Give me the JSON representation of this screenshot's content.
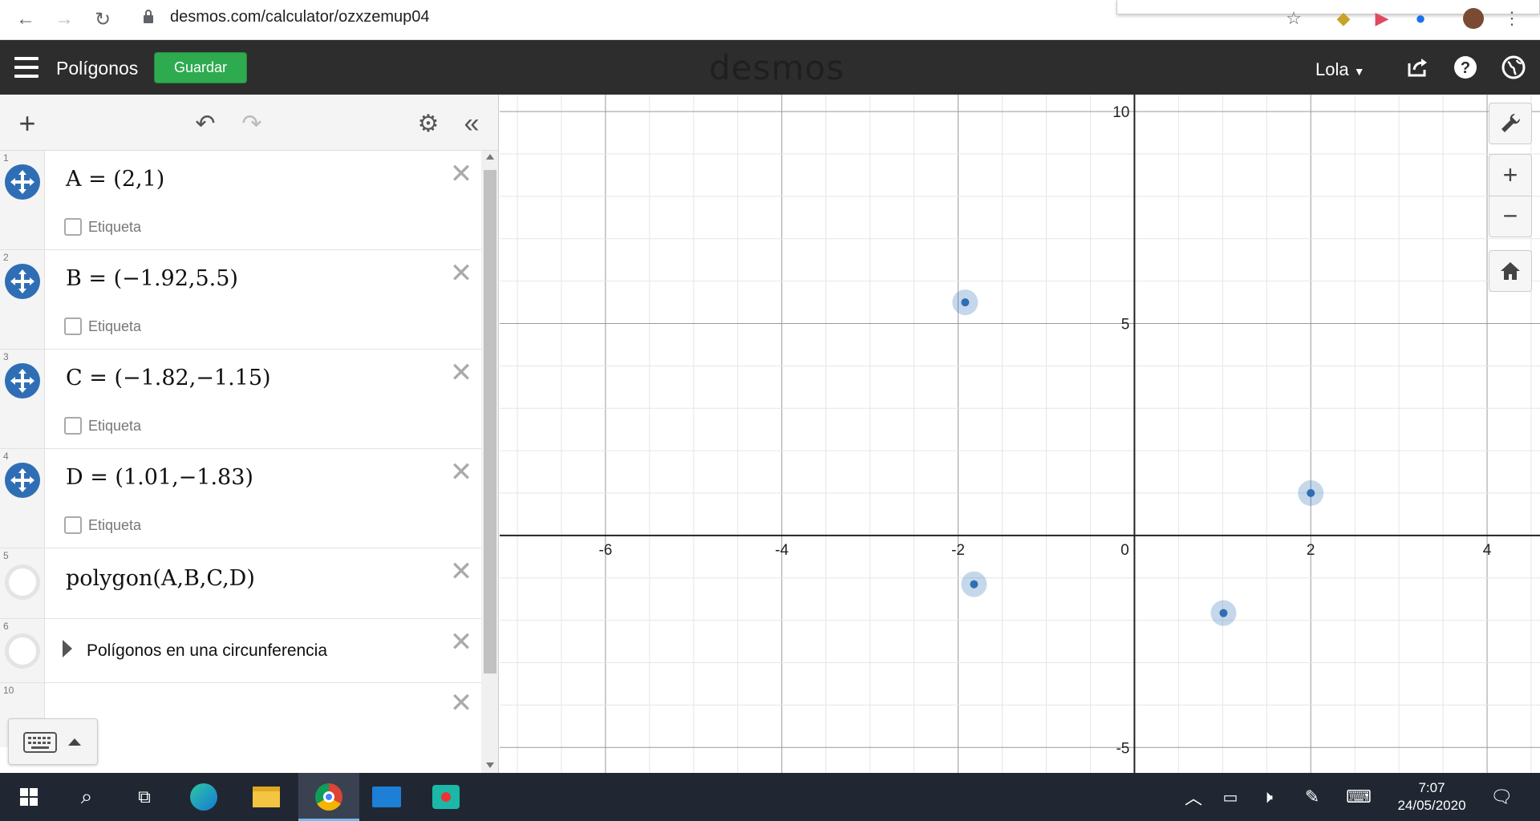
{
  "browser": {
    "url": "desmos.com/calculator/ozxzemup04"
  },
  "header": {
    "title": "Polígonos",
    "save_label": "Guardar",
    "brand": "desmos",
    "user": "Lola"
  },
  "expressions": [
    {
      "num": "1",
      "latex": "A = (2,1)",
      "label_toggle": "Etiqueta"
    },
    {
      "num": "2",
      "latex": "B = (−1.92,5.5)",
      "label_toggle": "Etiqueta"
    },
    {
      "num": "3",
      "latex": "C = (−1.82,−1.15)",
      "label_toggle": "Etiqueta"
    },
    {
      "num": "4",
      "latex": "D = (1.01,−1.83)",
      "label_toggle": "Etiqueta"
    },
    {
      "num": "5",
      "latex": "polygon(A,B,C,D)"
    },
    {
      "num": "6",
      "folder": "Polígonos en una circunferencia"
    },
    {
      "num": "10",
      "latex": ""
    }
  ],
  "graph": {
    "x_ticks": [
      "-6",
      "-4",
      "-2",
      "0",
      "2",
      "4"
    ],
    "y_ticks": [
      "10",
      "5",
      "-5"
    ],
    "xlim": [
      -7.2,
      4.6
    ],
    "ylim": [
      -5.6,
      10.4
    ],
    "points": [
      {
        "name": "A",
        "x": 2,
        "y": 1
      },
      {
        "name": "B",
        "x": -1.92,
        "y": 5.5
      },
      {
        "name": "C",
        "x": -1.82,
        "y": -1.15
      },
      {
        "name": "D",
        "x": 1.01,
        "y": -1.83
      }
    ],
    "point_color": "#2f6eb5"
  },
  "taskbar": {
    "time": "7:07",
    "date": "24/05/2020"
  }
}
